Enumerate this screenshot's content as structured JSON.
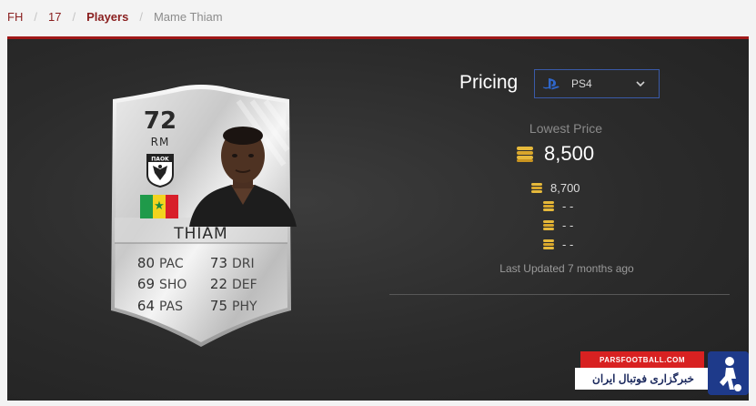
{
  "breadcrumb": {
    "items": [
      {
        "label": "FH"
      },
      {
        "label": "17"
      },
      {
        "label": "Players"
      }
    ],
    "current": "Mame Thiam"
  },
  "card": {
    "rating": "72",
    "position": "RM",
    "name": "THIAM",
    "club_badge_icon": "paok-crest-icon",
    "nation": "Senegal",
    "stats": [
      {
        "value": "80",
        "key": "PAC"
      },
      {
        "value": "73",
        "key": "DRI"
      },
      {
        "value": "69",
        "key": "SHO"
      },
      {
        "value": "22",
        "key": "DEF"
      },
      {
        "value": "64",
        "key": "PAS"
      },
      {
        "value": "75",
        "key": "PHY"
      }
    ]
  },
  "pricing": {
    "title": "Pricing",
    "platform": "PS4",
    "lowest_label": "Lowest Price",
    "lowest_value": "8,500",
    "alternates": [
      "8,700",
      "- -",
      "- -",
      "- -"
    ],
    "last_updated": "Last Updated 7 months ago"
  },
  "watermark": {
    "site": "PARSFOOTBALL.COM",
    "tagline": "خبرگزاری فوتبال ایران"
  },
  "colors": {
    "accent": "#a01818",
    "panel": "#2b2b2b",
    "link": "#8a1f1f",
    "platform_border": "#3a5aa8"
  }
}
